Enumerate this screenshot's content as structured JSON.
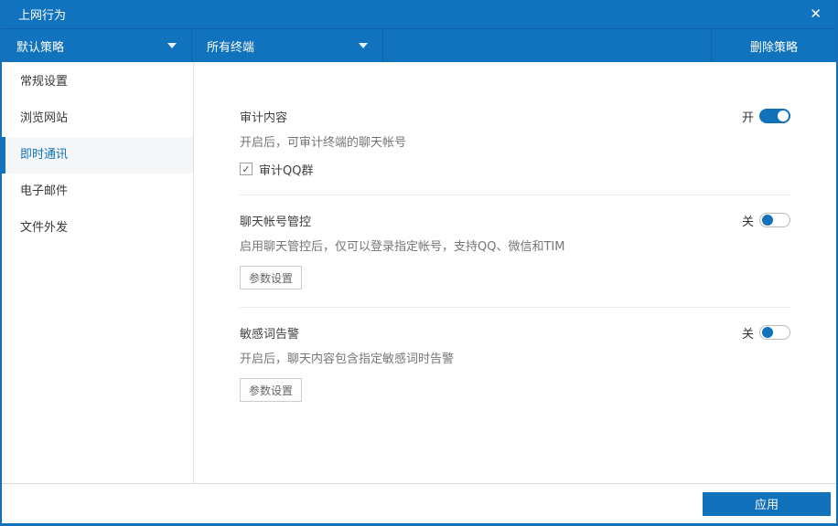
{
  "colors": {
    "brand_blue": "#1172bb",
    "header_divider_blue": "#0e64a6",
    "sidebar_selected_bg": "#f5f6f7",
    "section_divider": "#ececec",
    "text_title": "#404040",
    "text_description": "#757575"
  },
  "titlebar": {
    "title": "上网行为",
    "close_glyph": "✕"
  },
  "header": {
    "policy_dropdown_value": "默认策略",
    "terminal_dropdown_value": "所有终端",
    "delete_policy_label": "删除策略"
  },
  "sidebar": {
    "items": [
      {
        "label": "常规设置",
        "selected": false
      },
      {
        "label": "浏览网站",
        "selected": false
      },
      {
        "label": "即时通讯",
        "selected": true
      },
      {
        "label": "电子邮件",
        "selected": false
      },
      {
        "label": "文件外发",
        "selected": false
      }
    ]
  },
  "content": {
    "sections": [
      {
        "title": "审计内容",
        "toggle_state_label": "开",
        "toggle_on": true,
        "description": "开启后，可审计终端的聊天帐号",
        "checkbox": {
          "label": "审计QQ群",
          "checked": true,
          "check_glyph": "✓"
        }
      },
      {
        "title": "聊天帐号管控",
        "toggle_state_label": "关",
        "toggle_on": false,
        "description": "启用聊天管控后，仅可以登录指定帐号，支持QQ、微信和TIM",
        "button_label": "参数设置"
      },
      {
        "title": "敏感词告警",
        "toggle_state_label": "关",
        "toggle_on": false,
        "description": "开启后，聊天内容包含指定敏感词时告警",
        "button_label": "参数设置"
      }
    ]
  },
  "footer": {
    "apply_label": "应用"
  }
}
